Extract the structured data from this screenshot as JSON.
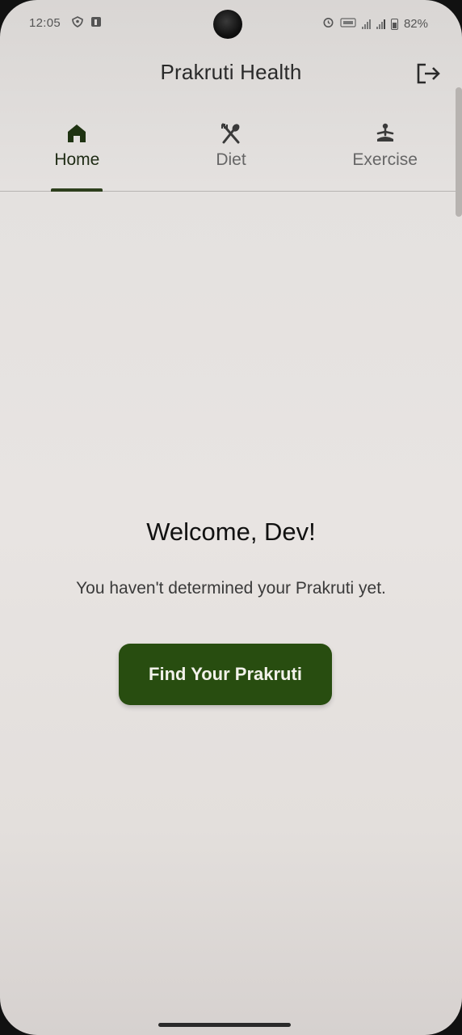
{
  "status_bar": {
    "time": "12:05",
    "battery": "82%",
    "left_icons": [
      "vpn-shield-icon",
      "app-notification-icon"
    ],
    "right_icons": [
      "alarm-icon",
      "volte-icon",
      "signal-1-icon",
      "signal-2-icon",
      "battery-icon"
    ]
  },
  "app_bar": {
    "title": "Prakruti Health",
    "logout_icon": "logout-icon"
  },
  "tabs": [
    {
      "label": "Home",
      "icon": "home-icon",
      "active": true
    },
    {
      "label": "Diet",
      "icon": "fork-spoon-icon",
      "active": false
    },
    {
      "label": "Exercise",
      "icon": "meditation-icon",
      "active": false
    }
  ],
  "main": {
    "welcome": "Welcome, Dev!",
    "subtext": "You haven't determined your Prakruti yet.",
    "cta_label": "Find Your Prakruti"
  },
  "colors": {
    "primary": "#284d10",
    "indicator": "#2d3f1d",
    "background": "#e6e2e0"
  }
}
